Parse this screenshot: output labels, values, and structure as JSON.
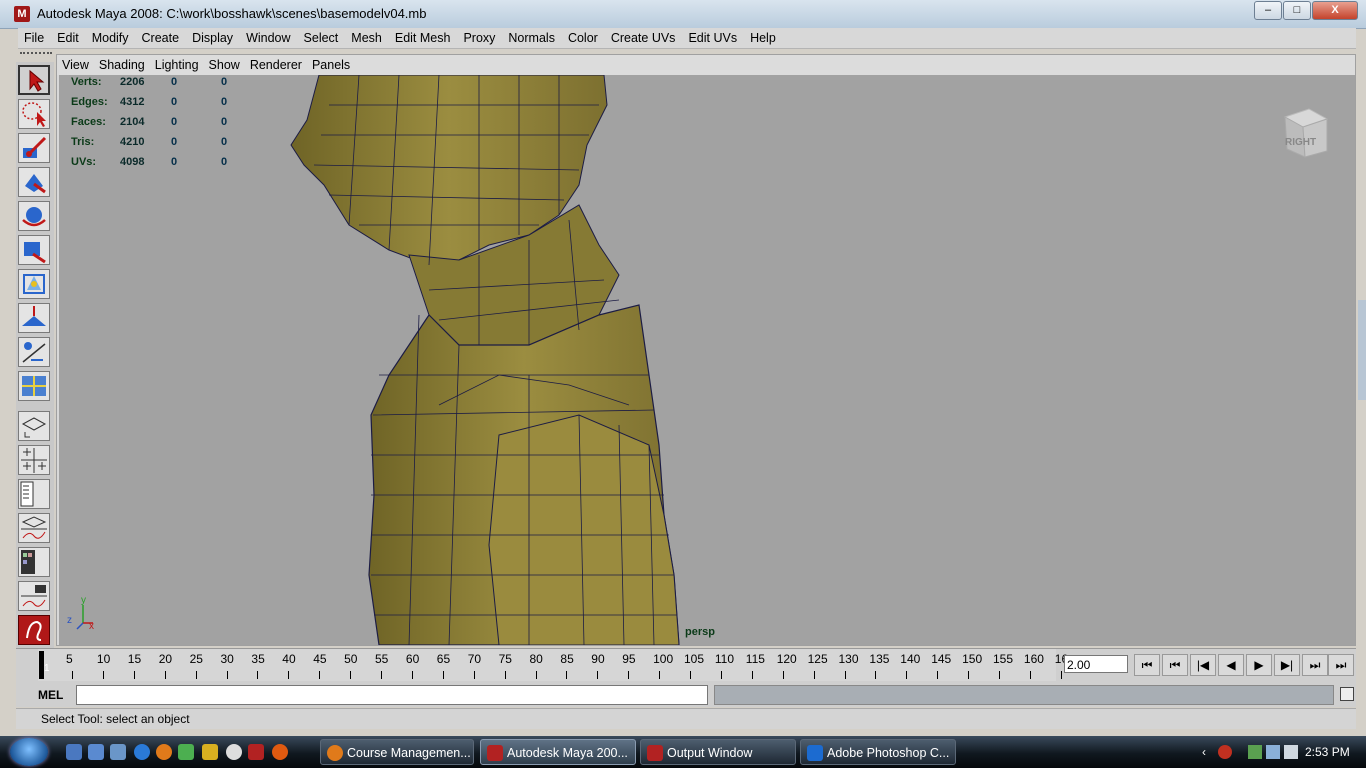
{
  "window": {
    "title": "Autodesk Maya 2008: C:\\work\\bosshawk\\scenes\\basemodelv04.mb",
    "minimize": "–",
    "maximize": "□",
    "close": "X"
  },
  "menubar": [
    "File",
    "Edit",
    "Modify",
    "Create",
    "Display",
    "Window",
    "Select",
    "Mesh",
    "Edit Mesh",
    "Proxy",
    "Normals",
    "Color",
    "Create UVs",
    "Edit UVs",
    "Help"
  ],
  "panel_menu": [
    "View",
    "Shading",
    "Lighting",
    "Show",
    "Renderer",
    "Panels"
  ],
  "hud": [
    {
      "label": "Verts:",
      "v1": "2206",
      "v2": "0",
      "v3": "0"
    },
    {
      "label": "Edges:",
      "v1": "4312",
      "v2": "0",
      "v3": "0"
    },
    {
      "label": "Faces:",
      "v1": "2104",
      "v2": "0",
      "v3": "0"
    },
    {
      "label": "Tris:",
      "v1": "4210",
      "v2": "0",
      "v3": "0"
    },
    {
      "label": "UVs:",
      "v1": "4098",
      "v2": "0",
      "v3": "0"
    }
  ],
  "viewcube_label": "RIGHT",
  "camera_label": "persp",
  "axis": {
    "x": "x",
    "y": "y",
    "z": "z"
  },
  "timeline": {
    "first_label": "1",
    "tick_labels": [
      "5",
      "10",
      "15",
      "20",
      "25",
      "30",
      "35",
      "40",
      "45",
      "50",
      "55",
      "60",
      "65",
      "70",
      "75",
      "80",
      "85",
      "90",
      "95",
      "100",
      "105",
      "110",
      "115",
      "120",
      "125",
      "130",
      "135",
      "140",
      "145",
      "150",
      "155",
      "160",
      "16"
    ],
    "current_time": "2.00"
  },
  "playback": [
    "⏮",
    "⏮",
    "|◀",
    "◀",
    "▶",
    "▶|",
    "⏭",
    "⏭"
  ],
  "command_line": {
    "label": "MEL",
    "value": ""
  },
  "help_line": "Select Tool: select an object",
  "taskbar": {
    "buttons": [
      {
        "label": "Course Managemen...",
        "color": "#e07a1a",
        "active": false
      },
      {
        "label": "Autodesk Maya 200...",
        "color": "#b22222",
        "active": true
      },
      {
        "label": "Output Window",
        "color": "#b22222",
        "active": false
      },
      {
        "label": "Adobe Photoshop C...",
        "color": "#1c6bd0",
        "active": false
      }
    ],
    "clock": "2:53 PM"
  },
  "colors": {
    "mesh": "#8f8238",
    "wire": "#1c1c44",
    "viewport": "#a2a2a2"
  }
}
